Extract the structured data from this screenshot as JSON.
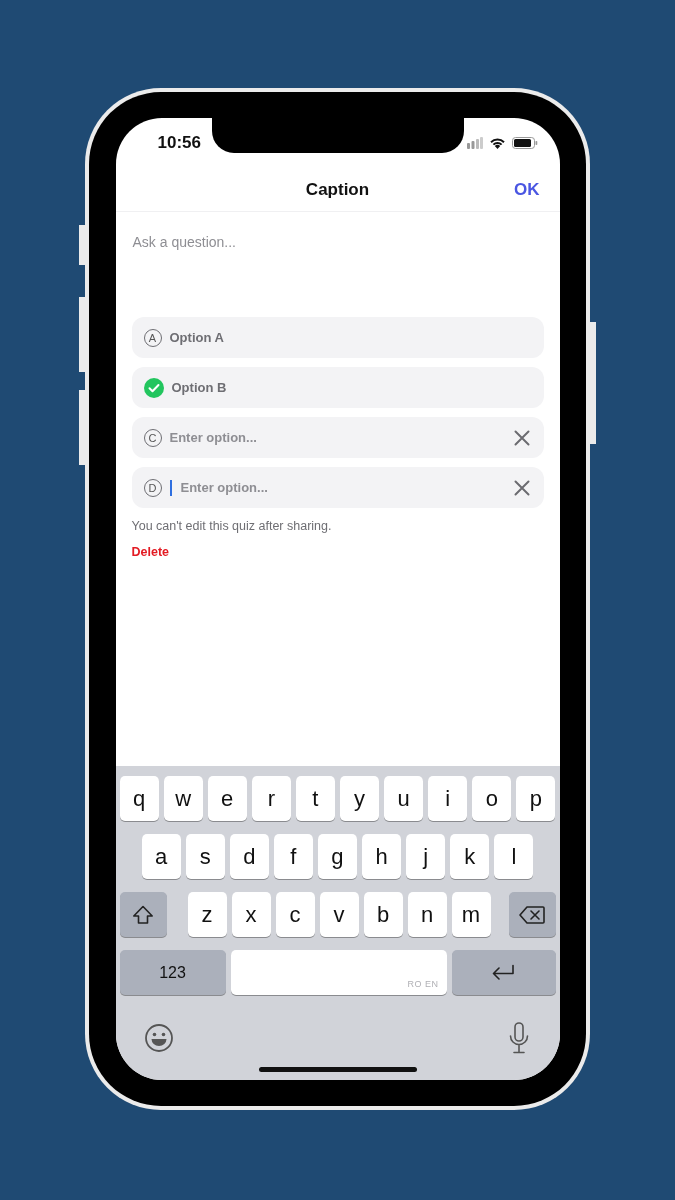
{
  "status_bar": {
    "time": "10:56"
  },
  "header": {
    "title": "Caption",
    "action": "OK"
  },
  "question": {
    "placeholder": "Ask a question..."
  },
  "options": [
    {
      "letter": "A",
      "value": "Option A",
      "selected": false,
      "clearable": false,
      "focused": false
    },
    {
      "value": "Option B",
      "selected": true,
      "clearable": false,
      "focused": false
    },
    {
      "letter": "C",
      "placeholder": "Enter option...",
      "selected": false,
      "clearable": true,
      "focused": false
    },
    {
      "letter": "D",
      "placeholder": "Enter option...",
      "selected": false,
      "clearable": true,
      "focused": true
    }
  ],
  "note": "You can't edit this quiz after sharing.",
  "delete_label": "Delete",
  "keyboard": {
    "top_row": [
      {
        "kind": "letter",
        "label": "q"
      },
      {
        "kind": "letter",
        "label": "w"
      },
      {
        "kind": "letter",
        "label": "e"
      },
      {
        "kind": "letter",
        "label": "r"
      },
      {
        "kind": "letter",
        "label": "t"
      },
      {
        "kind": "letter",
        "label": "y"
      },
      {
        "kind": "letter",
        "label": "u"
      },
      {
        "kind": "letter",
        "label": "i"
      },
      {
        "kind": "letter",
        "label": "o"
      },
      {
        "kind": "letter",
        "label": "p"
      }
    ],
    "middle_row": [
      {
        "kind": "letter",
        "label": "a"
      },
      {
        "kind": "letter",
        "label": "s"
      },
      {
        "kind": "letter",
        "label": "d"
      },
      {
        "kind": "letter",
        "label": "f"
      },
      {
        "kind": "letter",
        "label": "g"
      },
      {
        "kind": "letter",
        "label": "h"
      },
      {
        "kind": "letter",
        "label": "j"
      },
      {
        "kind": "letter",
        "label": "k"
      },
      {
        "kind": "letter",
        "label": "l"
      }
    ],
    "bottom_row": [
      {
        "kind": "shift"
      },
      {
        "kind": "letter",
        "label": "z"
      },
      {
        "kind": "letter",
        "label": "x"
      },
      {
        "kind": "letter",
        "label": "c"
      },
      {
        "kind": "letter",
        "label": "v"
      },
      {
        "kind": "letter",
        "label": "b"
      },
      {
        "kind": "letter",
        "label": "n"
      },
      {
        "kind": "letter",
        "label": "m"
      },
      {
        "kind": "backspace"
      }
    ],
    "function_row": [
      {
        "kind": "numbers",
        "label": "123"
      },
      {
        "kind": "space",
        "label": "RO EN"
      },
      {
        "kind": "return"
      }
    ]
  }
}
